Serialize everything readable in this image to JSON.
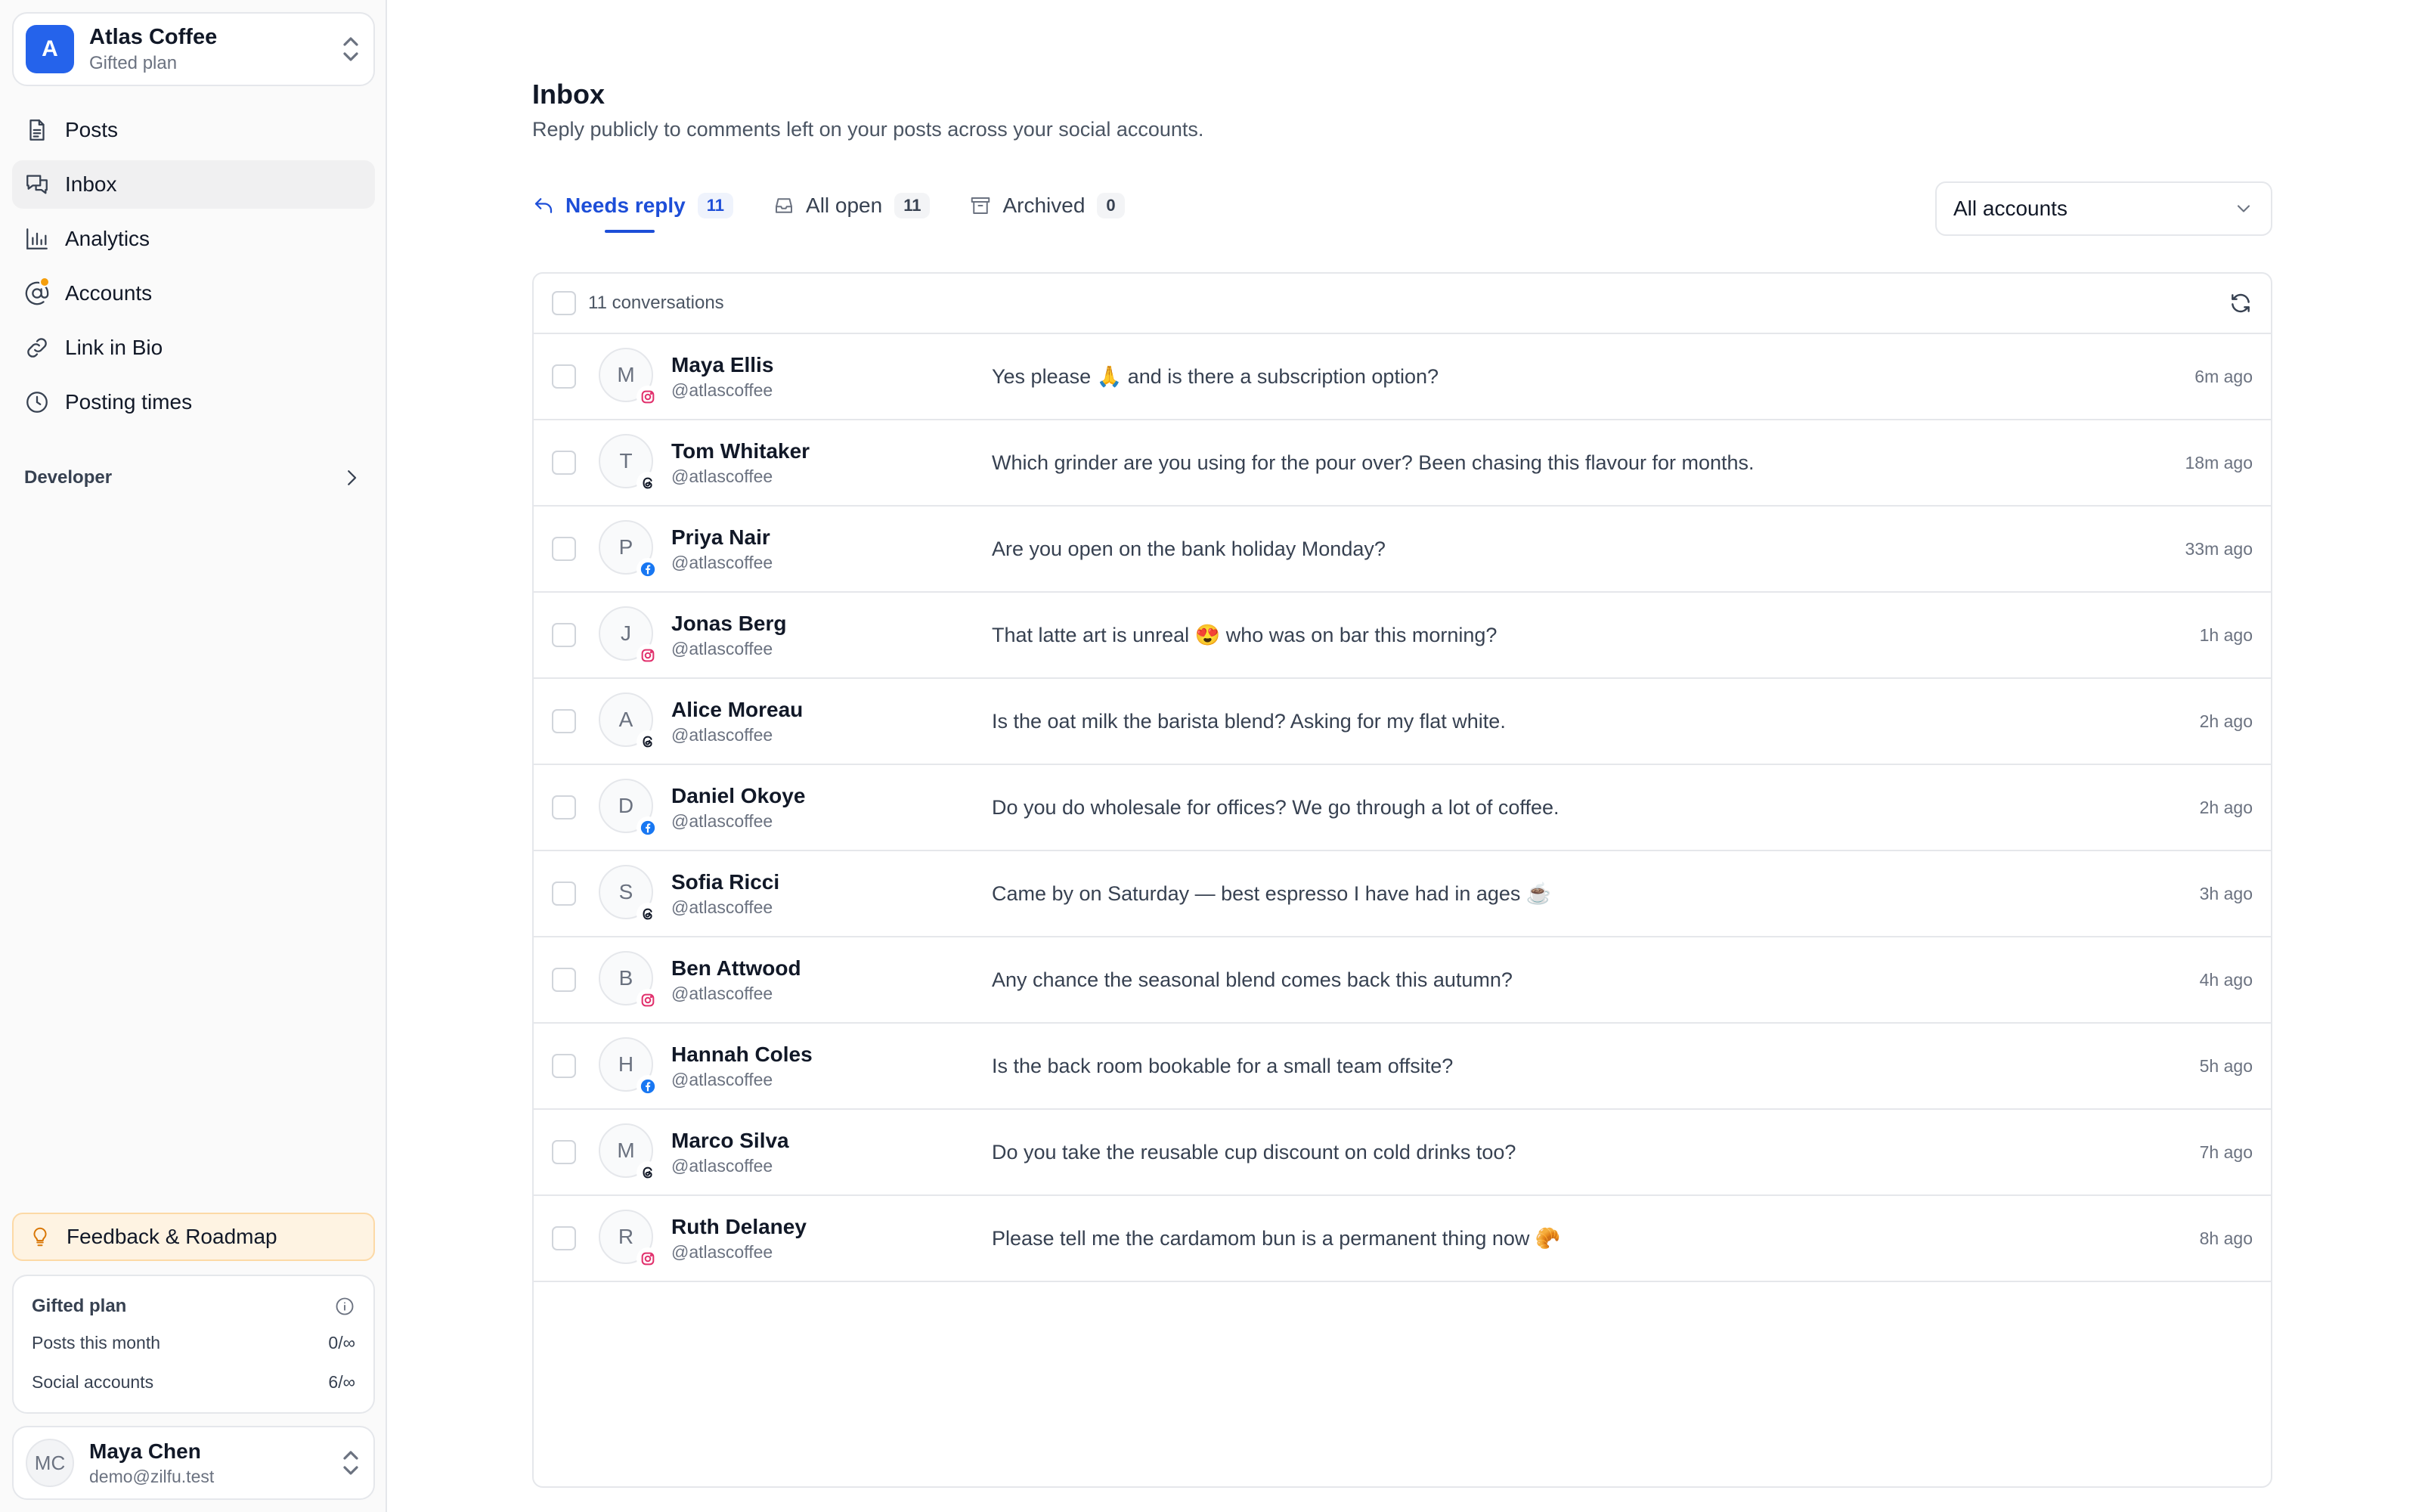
{
  "workspace": {
    "initial": "A",
    "name": "Atlas Coffee",
    "plan": "Gifted plan"
  },
  "nav": [
    {
      "label": "Posts",
      "icon": "document-icon"
    },
    {
      "label": "Inbox",
      "icon": "chat-bubbles-icon",
      "active": true
    },
    {
      "label": "Analytics",
      "icon": "bar-chart-icon"
    },
    {
      "label": "Accounts",
      "icon": "at-sign-icon",
      "badge": true
    },
    {
      "label": "Link in Bio",
      "icon": "link-icon"
    },
    {
      "label": "Posting times",
      "icon": "clock-icon"
    }
  ],
  "developer": {
    "label": "Developer"
  },
  "feedback": {
    "label": "Feedback & Roadmap"
  },
  "plan_card": {
    "title": "Gifted plan",
    "posts_label": "Posts this month",
    "posts_value": "0/∞",
    "accounts_label": "Social accounts",
    "accounts_value": "6/∞"
  },
  "user": {
    "initials": "MC",
    "name": "Maya Chen",
    "email": "demo@zilfu.test"
  },
  "page": {
    "title": "Inbox",
    "subtitle": "Reply publicly to comments left on your posts across your social accounts."
  },
  "tabs": [
    {
      "label": "Needs reply",
      "count": "11",
      "active": true
    },
    {
      "label": "All open",
      "count": "11"
    },
    {
      "label": "Archived",
      "count": "0"
    }
  ],
  "account_filter": {
    "value": "All accounts"
  },
  "table": {
    "header_label": "11 conversations"
  },
  "colors": {
    "accent": "#1d4ed8",
    "brand": "#2563eb",
    "instagram": "#e1306c",
    "facebook": "#1877f2",
    "threads": "#111827"
  },
  "conversations": [
    {
      "initial": "M",
      "name": "Maya Ellis",
      "handle": "@atlascoffee",
      "platform": "instagram",
      "message": "Yes please 🙏 and is there a subscription option?",
      "time": "6m ago"
    },
    {
      "initial": "T",
      "name": "Tom Whitaker",
      "handle": "@atlascoffee",
      "platform": "threads",
      "message": "Which grinder are you using for the pour over? Been chasing this flavour for months.",
      "time": "18m ago"
    },
    {
      "initial": "P",
      "name": "Priya Nair",
      "handle": "@atlascoffee",
      "platform": "facebook",
      "message": "Are you open on the bank holiday Monday?",
      "time": "33m ago"
    },
    {
      "initial": "J",
      "name": "Jonas Berg",
      "handle": "@atlascoffee",
      "platform": "instagram",
      "message": "That latte art is unreal 😍 who was on bar this morning?",
      "time": "1h ago"
    },
    {
      "initial": "A",
      "name": "Alice Moreau",
      "handle": "@atlascoffee",
      "platform": "threads",
      "message": "Is the oat milk the barista blend? Asking for my flat white.",
      "time": "2h ago"
    },
    {
      "initial": "D",
      "name": "Daniel Okoye",
      "handle": "@atlascoffee",
      "platform": "facebook",
      "message": "Do you do wholesale for offices? We go through a lot of coffee.",
      "time": "2h ago"
    },
    {
      "initial": "S",
      "name": "Sofia Ricci",
      "handle": "@atlascoffee",
      "platform": "threads",
      "message": "Came by on Saturday — best espresso I have had in ages ☕",
      "time": "3h ago"
    },
    {
      "initial": "B",
      "name": "Ben Attwood",
      "handle": "@atlascoffee",
      "platform": "instagram",
      "message": "Any chance the seasonal blend comes back this autumn?",
      "time": "4h ago"
    },
    {
      "initial": "H",
      "name": "Hannah Coles",
      "handle": "@atlascoffee",
      "platform": "facebook",
      "message": "Is the back room bookable for a small team offsite?",
      "time": "5h ago"
    },
    {
      "initial": "M",
      "name": "Marco Silva",
      "handle": "@atlascoffee",
      "platform": "threads",
      "message": "Do you take the reusable cup discount on cold drinks too?",
      "time": "7h ago"
    },
    {
      "initial": "R",
      "name": "Ruth Delaney",
      "handle": "@atlascoffee",
      "platform": "instagram",
      "message": "Please tell me the cardamom bun is a permanent thing now 🥐",
      "time": "8h ago"
    }
  ]
}
